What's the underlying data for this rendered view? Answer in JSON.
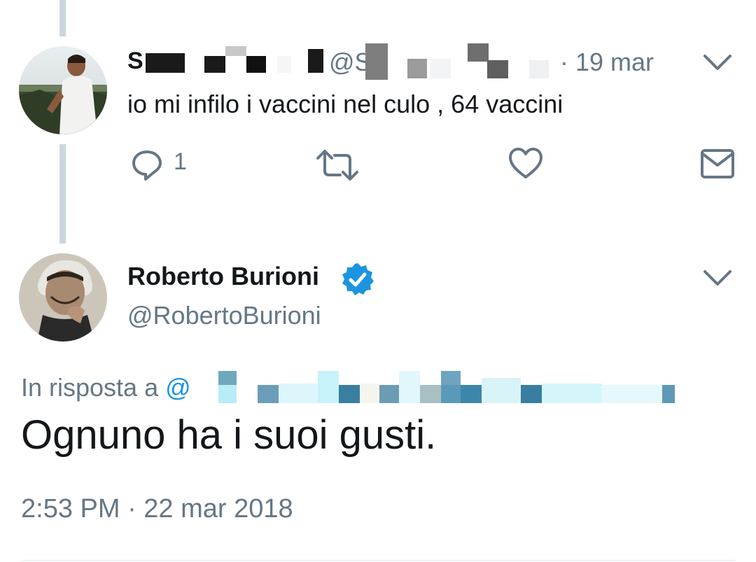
{
  "reply_tweet": {
    "name_visible": "S",
    "handle_visible": "@S",
    "date": "· 19 mar",
    "text": "io mi infilo i vaccini nel culo , 64 vaccini",
    "reply_count": "1"
  },
  "main_tweet": {
    "name": "Roberto Burioni",
    "handle": "@RobertoBurioni",
    "in_reply_to_label": "In risposta a",
    "in_reply_to_at": "@",
    "text": "Ognuno ha i suoi gusti.",
    "timestamp": "2:53 PM · 22 mar 2018"
  },
  "colors": {
    "verified": "#1b95e0",
    "secondary_text": "#657786",
    "thread_line": "#ccd6dd"
  },
  "icons": {
    "reply": "speech-bubble-icon",
    "retweet": "retweet-icon",
    "like": "heart-icon",
    "dm": "envelope-icon",
    "more": "chevron-down-icon",
    "verified": "verified-badge-icon"
  }
}
